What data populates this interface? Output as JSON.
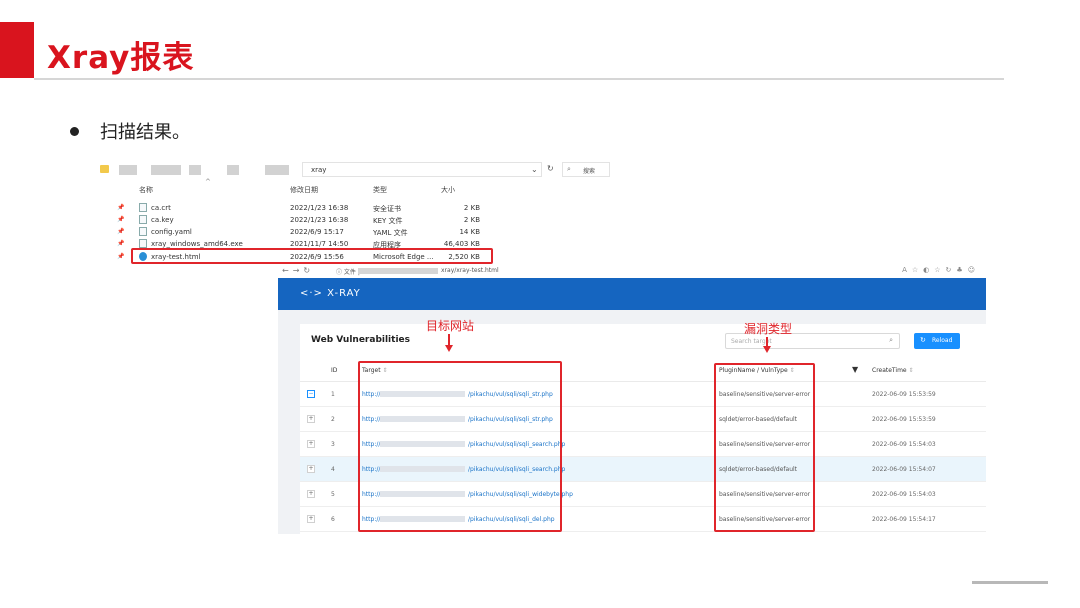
{
  "slide": {
    "title": "Xray报表",
    "bullet": "扫描结果。"
  },
  "colors": {
    "accent": "#d9141e",
    "browser_header": "#1565c0",
    "button": "#1890ff",
    "highlight_border": "#e0252b"
  },
  "explorer": {
    "path": "xray",
    "search_placeholder": "搜索",
    "columns": {
      "name": "名称",
      "date": "修改日期",
      "type": "类型",
      "size": "大小"
    },
    "files": [
      {
        "name": "ca.crt",
        "date": "2022/1/23 16:38",
        "type": "安全证书",
        "size": "2 KB",
        "icon": "certificate-icon"
      },
      {
        "name": "ca.key",
        "date": "2022/1/23 16:38",
        "type": "KEY 文件",
        "size": "2 KB",
        "icon": "file-icon"
      },
      {
        "name": "config.yaml",
        "date": "2022/6/9 15:17",
        "type": "YAML 文件",
        "size": "14 KB",
        "icon": "yaml-file-icon"
      },
      {
        "name": "xray_windows_amd64.exe",
        "date": "2021/11/7 14:50",
        "type": "应用程序",
        "size": "46,403 KB",
        "icon": "exe-icon"
      },
      {
        "name": "xray-test.html",
        "date": "2022/6/9 15:56",
        "type": "Microsoft Edge ...",
        "size": "2,520 KB",
        "icon": "edge-icon"
      }
    ]
  },
  "browser": {
    "url_prefix": "ⓘ 文件 |",
    "url_suffix": "xray/xray-test.html",
    "logo": "<·> X-RAY",
    "card_title": "Web Vulnerabilities",
    "search_placeholder": "Search target",
    "reload_label": "Reload",
    "columns": {
      "id": "ID",
      "target": "Target",
      "plugin": "PluginName / VulnType",
      "time": "CreateTime"
    },
    "rows": [
      {
        "id": "1",
        "scheme": "http://",
        "path": "/pikachu/vul/sqli/sqli_str.php",
        "plugin": "baseline/sensitive/server-error",
        "time": "2022-06-09 15:53:59"
      },
      {
        "id": "2",
        "scheme": "http://",
        "path": "/pikachu/vul/sqli/sqli_str.php",
        "plugin": "sqldet/error-based/default",
        "time": "2022-06-09 15:53:59"
      },
      {
        "id": "3",
        "scheme": "http://",
        "path": "/pikachu/vul/sqli/sqli_search.php",
        "plugin": "baseline/sensitive/server-error",
        "time": "2022-06-09 15:54:03"
      },
      {
        "id": "4",
        "scheme": "http://",
        "path": "/pikachu/vul/sqli/sqli_search.php",
        "plugin": "sqldet/error-based/default",
        "time": "2022-06-09 15:54:07"
      },
      {
        "id": "5",
        "scheme": "http://",
        "path": "/pikachu/vul/sqli/sqli_widebyte.php",
        "plugin": "baseline/sensitive/server-error",
        "time": "2022-06-09 15:54:03"
      },
      {
        "id": "6",
        "scheme": "http://",
        "path": "/pikachu/vul/sqli/sqli_del.php",
        "plugin": "baseline/sensitive/server-error",
        "time": "2022-06-09 15:54:17"
      }
    ]
  },
  "annotations": {
    "target_label": "目标网站",
    "vulntype_label": "漏洞类型"
  }
}
